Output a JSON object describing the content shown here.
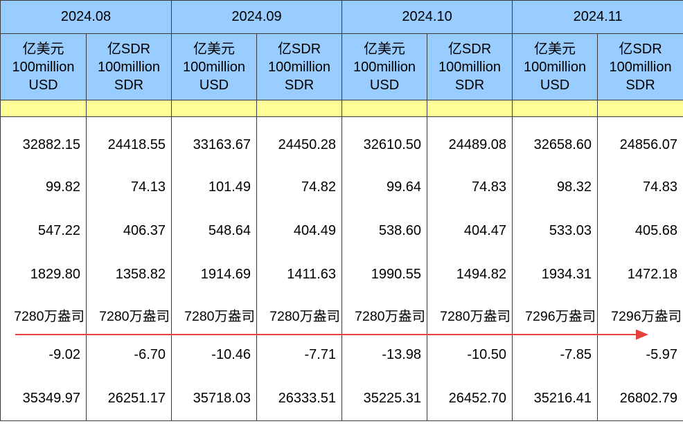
{
  "months": [
    "2024.08",
    "2024.09",
    "2024.10",
    "2024.11"
  ],
  "units": [
    {
      "zh": "亿美元",
      "en1": "100million",
      "en2": "USD"
    },
    {
      "zh": "亿SDR",
      "en1": "100million",
      "en2": "SDR"
    }
  ],
  "rows": [
    [
      "32882.15",
      "24418.55",
      "33163.67",
      "24450.28",
      "32610.50",
      "24489.08",
      "32658.60",
      "24856.07"
    ],
    [
      "99.82",
      "74.13",
      "101.49",
      "74.82",
      "99.64",
      "74.83",
      "98.32",
      "74.83"
    ],
    [
      "547.22",
      "406.37",
      "548.64",
      "404.49",
      "538.60",
      "404.47",
      "533.03",
      "405.68"
    ],
    [
      "1829.80",
      "1358.82",
      "1914.69",
      "1411.63",
      "1990.55",
      "1494.82",
      "1934.31",
      "1472.18"
    ],
    [
      "7280万盎司",
      "7280万盎司",
      "7280万盎司",
      "7280万盎司",
      "7280万盎司",
      "7280万盎司",
      "7296万盎司",
      "7296万盎司"
    ],
    [
      "-9.02",
      "-6.70",
      "-10.46",
      "-7.71",
      "-13.98",
      "-10.50",
      "-7.85",
      "-5.97"
    ],
    [
      "35349.97",
      "26251.17",
      "35718.03",
      "26333.51",
      "35225.31",
      "26452.70",
      "35216.41",
      "26802.79"
    ]
  ],
  "colors": {
    "header": "#99ccff",
    "highlight_strip": "#ffff99",
    "arrow": "#e8403a"
  },
  "annotation": {
    "type": "arrow",
    "direction": "right",
    "color": "#e8403a"
  }
}
